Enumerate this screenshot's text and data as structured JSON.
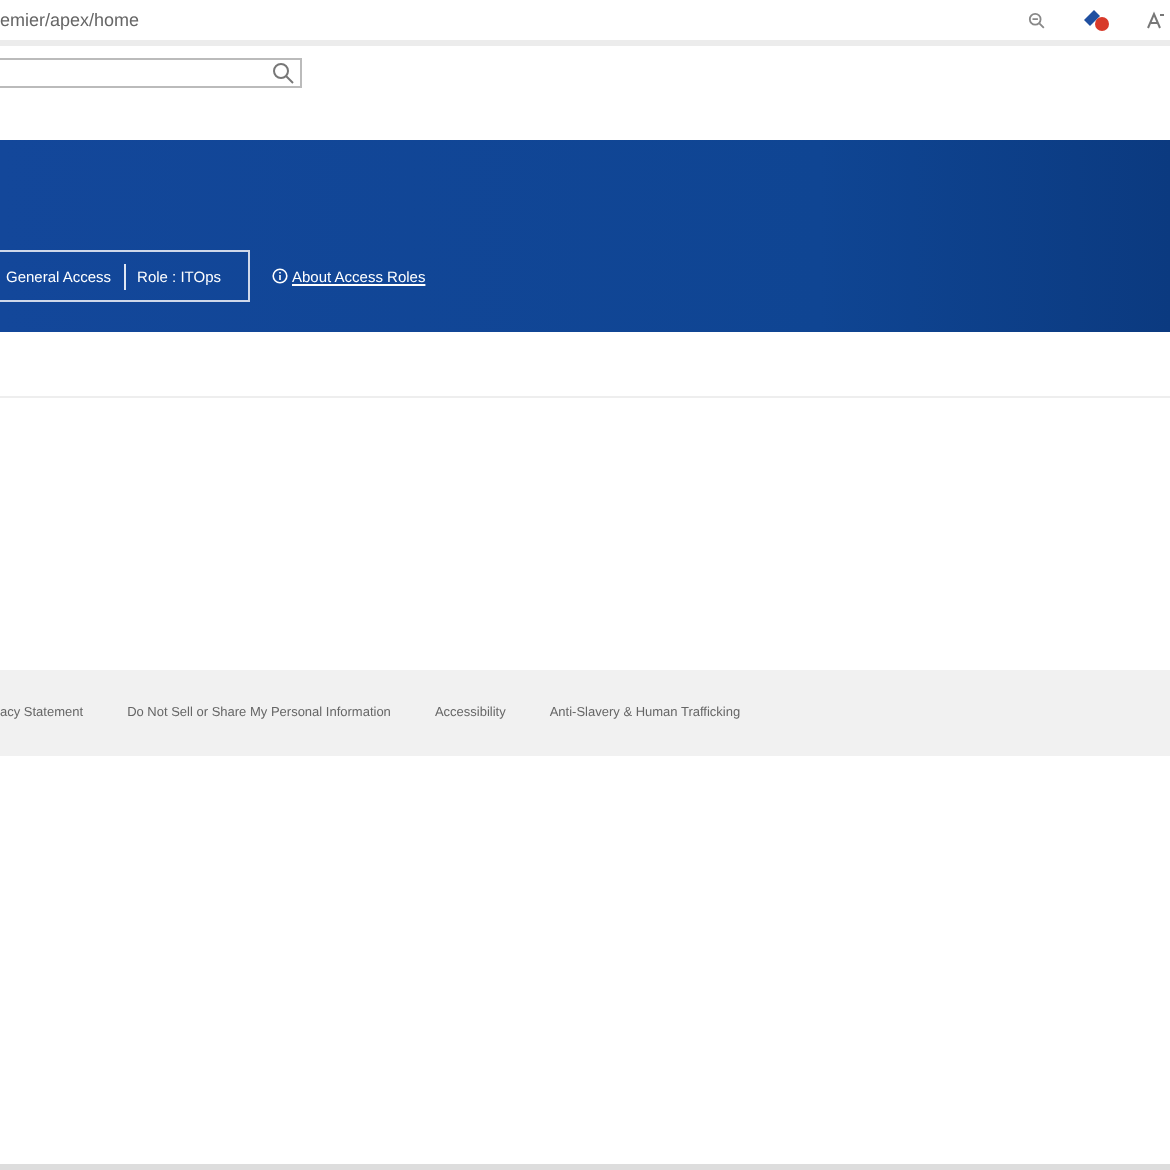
{
  "address_bar": {
    "url": "emier/apex/home"
  },
  "banner": {
    "access": "General Access",
    "role_label": "Role :",
    "role": "ITOps",
    "link": "About Access Roles"
  },
  "footer": {
    "links": [
      "acy Statement",
      "Do Not Sell or Share My Personal Information",
      "Accessibility",
      "Anti-Slavery & Human Trafficking"
    ]
  }
}
